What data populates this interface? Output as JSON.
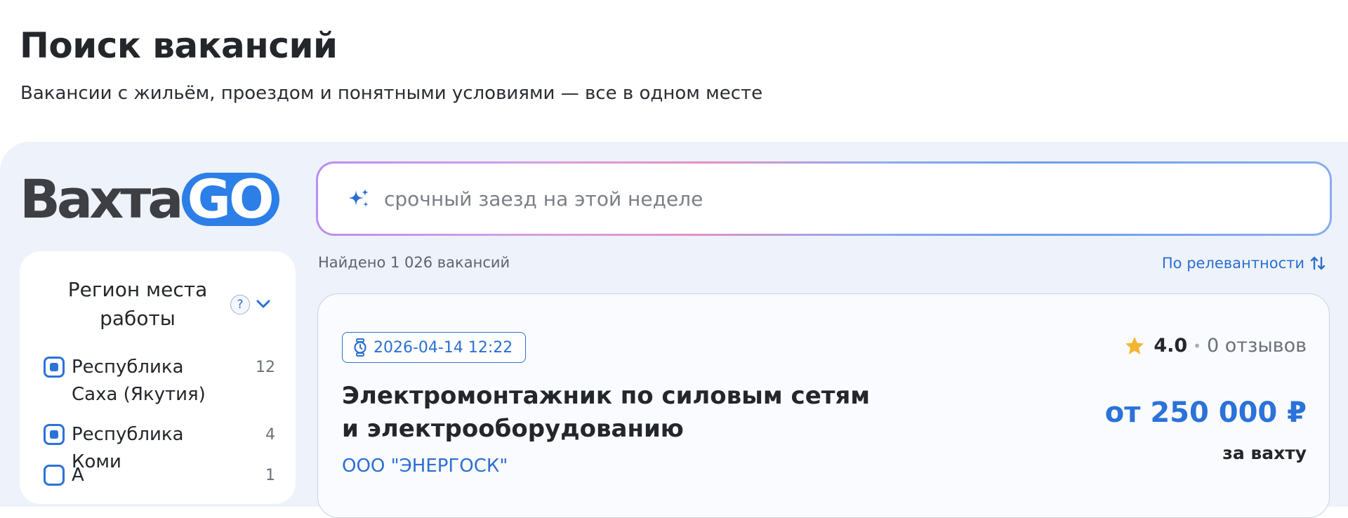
{
  "page": {
    "title": "Поиск вакансий",
    "subtitle": "Вакансии с жильём, проездом и понятными условиями — все в одном месте"
  },
  "logo": {
    "part1": "Вахта",
    "part2": "GO"
  },
  "colors": {
    "accent": "#2b72d9",
    "panel_bg": "#eef2fa",
    "star": "#f2b530"
  },
  "filters": {
    "title": "Регион места работы",
    "help_label": "?",
    "items": [
      {
        "label": "Республика Саха (Якутия)",
        "count": "12",
        "checked": true
      },
      {
        "label": "Республика Коми",
        "count": "4",
        "checked": true
      },
      {
        "label": "А",
        "count": "1",
        "checked": false
      }
    ]
  },
  "search": {
    "placeholder": "срочный заезд на этой неделе",
    "value": "",
    "icon": "sparkle-icon"
  },
  "results": {
    "count_text": "Найдено 1 026 вакансий",
    "sort_label": "По релевантности"
  },
  "job": {
    "date": "2026-04-14 12:22",
    "title": "Электромонтажник по силовым сетям и электрооборудованию",
    "company": "ООО \"ЭНЕРГОСК\"",
    "rating": "4.0",
    "rating_separator": "•",
    "reviews": "0 отзывов",
    "salary": "от 250 000 ₽",
    "salary_period": "за вахту"
  }
}
